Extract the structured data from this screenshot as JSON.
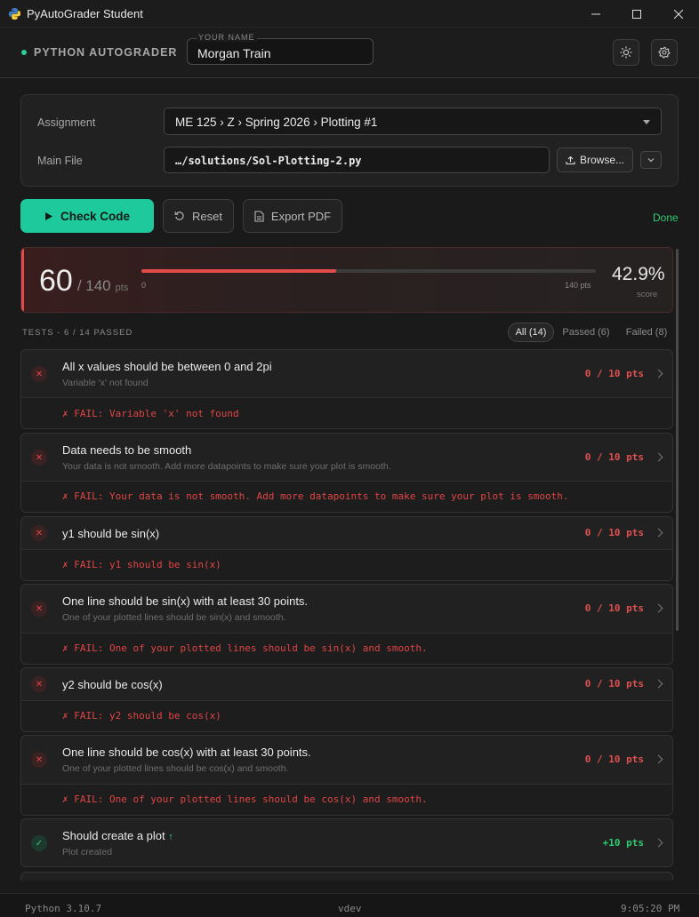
{
  "window": {
    "title": "PyAutoGrader Student"
  },
  "header": {
    "brand": "PYTHON AUTOGRADER",
    "name_label": "YOUR NAME",
    "name_value": "Morgan Train"
  },
  "form": {
    "assignment_label": "Assignment",
    "assignment_value": "ME 125 › Z › Spring 2026 › Plotting #1",
    "file_label": "Main File",
    "file_value": "…/solutions/Sol-Plotting-2.py",
    "browse_label": "Browse..."
  },
  "actions": {
    "check_label": "Check Code",
    "reset_label": "Reset",
    "export_label": "Export PDF",
    "status": "Done"
  },
  "score": {
    "points": "60",
    "total": "/ 140",
    "unit": "pts",
    "progress_fraction": 0.429,
    "tick_min": "0",
    "tick_max": "140 pts",
    "percent": "42.9%",
    "percent_label": "score"
  },
  "tests": {
    "heading": "TESTS - 6 / 14 PASSED",
    "filters": {
      "all": "All (14)",
      "passed": "Passed (6)",
      "failed": "Failed (8)"
    },
    "items": [
      {
        "title": "All x values should be between 0 and 2pi",
        "desc": "Variable 'x' not found",
        "score": "0 / 10 pts",
        "status": "fail",
        "message": "✗ FAIL: Variable 'x' not found"
      },
      {
        "title": "Data needs to be smooth",
        "desc": "Your data is not smooth. Add more datapoints to make sure your plot is smooth.",
        "score": "0 / 10 pts",
        "status": "fail",
        "message": "✗ FAIL: Your data is not smooth. Add more datapoints to make sure your plot is smooth."
      },
      {
        "title": "y1 should be sin(x)",
        "desc": "",
        "score": "0 / 10 pts",
        "status": "fail",
        "message": "✗ FAIL: y1 should be sin(x)"
      },
      {
        "title": "One line should be sin(x) with at least 30 points.",
        "desc": "One of your plotted lines should be sin(x) and smooth.",
        "score": "0 / 10 pts",
        "status": "fail",
        "message": "✗ FAIL: One of your plotted lines should be sin(x) and smooth."
      },
      {
        "title": "y2 should be cos(x)",
        "desc": "",
        "score": "0 / 10 pts",
        "status": "fail",
        "message": "✗ FAIL: y2 should be cos(x)"
      },
      {
        "title": "One line should be cos(x) with at least 30 points.",
        "desc": "One of your plotted lines should be cos(x) and smooth.",
        "score": "0 / 10 pts",
        "status": "fail",
        "message": "✗ FAIL: One of your plotted lines should be cos(x) and smooth."
      },
      {
        "title": "Should create a plot",
        "title_suffix": "↑",
        "desc": "Plot created",
        "score": "+10 pts",
        "status": "pass",
        "message": ""
      }
    ]
  },
  "statusbar": {
    "python": "Python 3.10.7",
    "version": "vdev",
    "time": "9:05:20 PM"
  },
  "colors": {
    "accent": "#1ec99b",
    "fail": "#e04545",
    "pass": "#2ecc71",
    "background": "#1a1a1a"
  }
}
